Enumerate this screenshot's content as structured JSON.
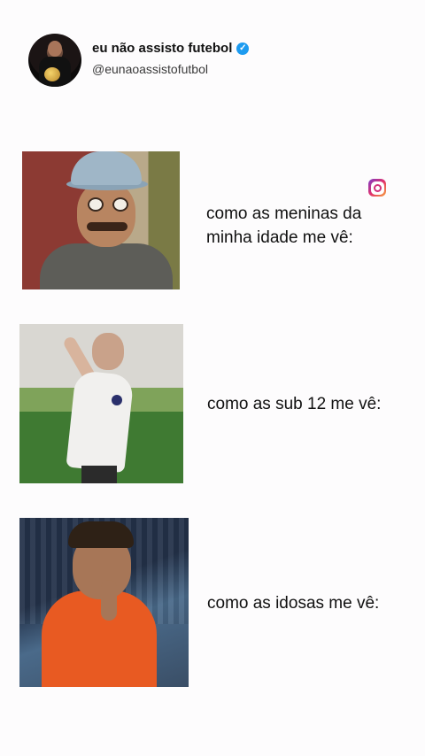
{
  "post": {
    "author_name": "eu não assisto futebol",
    "handle": "@eunaoassistofutbol",
    "verified_mark": "✓"
  },
  "rows": [
    {
      "caption": "como as meninas da\nminha idade me vê:"
    },
    {
      "caption": "como as sub 12 me vê:"
    },
    {
      "caption": "como as idosas me vê:"
    }
  ],
  "icons": {
    "avatar": "profile-avatar",
    "verified": "verified-badge-icon",
    "instagram": "instagram-icon"
  },
  "colors": {
    "verified_blue": "#1d9bf0",
    "background": "#fdfcfd"
  }
}
